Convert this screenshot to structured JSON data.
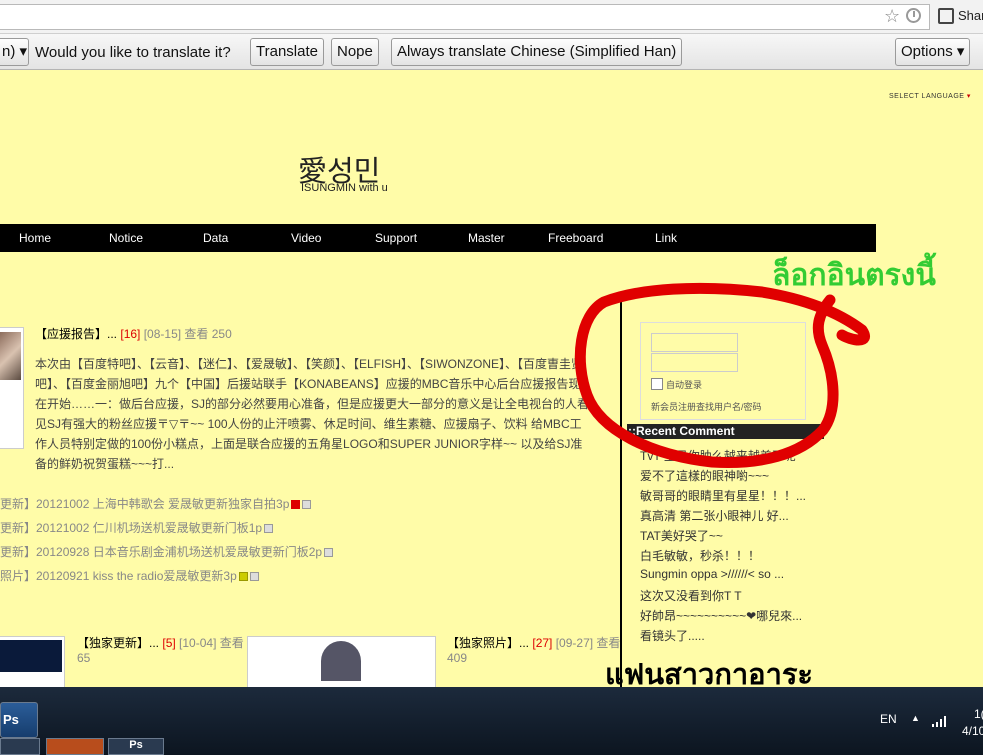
{
  "browser": {
    "share_label": "Shar",
    "translate_bar": {
      "language_select": "n)",
      "prompt": "Would you like to translate it?",
      "translate_button": "Translate",
      "nope_button": "Nope",
      "always_button": "Always translate Chinese (Simplified Han)",
      "options_button": "Options"
    }
  },
  "site": {
    "select_language": "SELECT LANGUAGE",
    "logo_text": "愛성민",
    "logo_subtitle": "ISUNGMIN with u",
    "nav": [
      "Home",
      "Notice",
      "Data",
      "Video",
      "Support",
      "Master",
      "Freeboard",
      "Link"
    ],
    "featured": {
      "title": "【应援报告】...",
      "comments": "[16]",
      "meta": "[08-15] 查看 250",
      "body": "本次由【百度特吧】、【云音】、【迷仁】、【爱晟敏】、【笑颜】、【ELFISH】、【SIWONZONE】、【百度曺圭贤吧】、【百度金丽旭吧】九个【中国】后援站联手【KONABEANS】应援的MBC音乐中心后台应援报告现在开始……一：做后台应援，SJ的部分必然要用心准备，但是应援更大一部分的意义是让全电视台的人看见SJ有强大的粉丝应援〒▽〒~~ 100人份的止汗喷雾、休足时间、维生素糖、应援扇子、饮料 给MBC工作人员特别定做的100份小糕点，上面是联合应援的五角星LOGO和SUPER JUNIOR字样~~ 以及给SJ准备的鲜奶祝贺蛋糕~~~打..."
    },
    "recent_posts": [
      "更新】20121002 上海中韩歌会 爱晟敏更新独家自拍3p",
      "更新】20121002 仁川机场送机爱晟敏更新门板1p",
      "更新】20120928 日本音乐剧金浦机场送机爱晟敏更新门板2p",
      "照片】20120921 kiss the radio爱晟敏更新3p"
    ],
    "post2": {
      "title": "【独家更新】...",
      "comments": "[5]",
      "meta": "[10-04] 查看",
      "views": "65"
    },
    "post3": {
      "title": "【独家照片】...",
      "comments": "[27]",
      "meta": "[09-27] 查看",
      "views": "409"
    },
    "sidebar": {
      "auto_login": "自动登录",
      "register": "新会员注册查找用户名/密码",
      "recent_comment_title": "::Recent Comment",
      "recent_comments": [
        "TvT 宝贝你肿么越来越美了呢",
        "爱不了這樣的眼神喲~~~",
        "敏哥哥的眼睛里有星星！！！...",
        "真高清 第二张小眼神儿 好...",
        "TAT美好哭了~~",
        "白毛敏敏，秒杀！！！",
        "Sungmin oppa >//////< so ...",
        "这次又没看到你T T",
        "好帥昂~~~~~~~~~~❤哪兒來...",
        "看镜头了....."
      ]
    }
  },
  "annotations": {
    "login_here_thai": "ล็อกอินตรงนี้",
    "fangirl_thai": "แฟนสาวกาอาระ",
    "circle_color": "#e00000"
  },
  "taskbar": {
    "ps_label": "Ps",
    "tray_language": "EN",
    "time": "1(",
    "date": "4/10"
  }
}
